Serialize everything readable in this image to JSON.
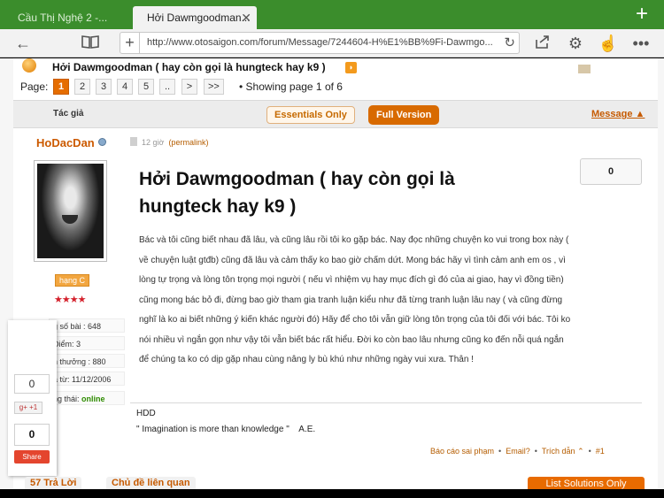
{
  "browser": {
    "tabs": [
      {
        "label": "Cầu Thị Nghệ 2 -...",
        "active": false
      },
      {
        "label": "Hởi Dawmgoodman...",
        "active": true
      }
    ],
    "url": "http://www.otosaigon.com/forum/Message/7244604-H%E1%BB%9Fi-Dawmgo...",
    "icons": [
      "back-icon",
      "reader-icon",
      "new-tab-icon",
      "reload-icon",
      "share-icon",
      "settings-icon",
      "gesture-icon",
      "more-icon"
    ]
  },
  "thread": {
    "title": "Hởi Dawmgoodman ( hay còn gọi là hungteck hay k9 )"
  },
  "pagination": {
    "label": "Page:",
    "pages": [
      "1",
      "2",
      "3",
      "4",
      "5",
      "..",
      ">",
      ">>"
    ],
    "current": "1",
    "showing": "• Showing page 1 of 6"
  },
  "header": {
    "author_col": "Tác giả",
    "essentials": "Essentials Only",
    "full_version": "Full Version",
    "message": "Message ▲"
  },
  "author": {
    "name": "HoDacDan",
    "rank": "hạng C",
    "stars": "★★★★",
    "stats": [
      {
        "text": "g số bài : 648"
      },
      {
        "text": "Điểm: 3"
      },
      {
        "text": "h thưởng : 880"
      },
      {
        "text": "a từ: 11/12/2006"
      }
    ],
    "status_label": "ng thái: ",
    "status_value": "online"
  },
  "share": {
    "count_top": "0",
    "gplus": "g+ +1",
    "count_bottom": "0",
    "share_label": "Share"
  },
  "post": {
    "time": "12 giờ",
    "permalink": "(permalink)",
    "votes": "0",
    "title": "Hởi Dawmgoodman ( hay còn gọi là hungteck hay k9 )",
    "body": "Bác và tôi cũng biết nhau đã lâu, và cũng lâu rồi tôi ko gặp bác. Nay đọc những chuyện ko vui trong box này ( về chuyện luật gtđb) cũng đã lâu và cảm thấy ko bao giờ chấm dứt. Mong bác hãy vì tình cảm anh em os , vì lòng tự trọng và lòng tôn trọng mọi người ( nếu vì nhiệm vụ hay mục đích gì đó của ai giao, hay vì đồng tiền) cũng mong bác bỏ đi, đừng bao giờ tham gia tranh luận kiểu như đã từng tranh luận lâu nay ( và cũng đừng nghĩ là ko ai biết những ý kiến khác người đó) Hãy để cho tôi vẫn giữ lòng tôn trọng của tôi đối với bác. Tôi ko nói nhiều vì ngắn gọn như vậy tôi vẫn biết bác rất hiểu. Đời ko còn bao lâu nhưng cũng ko đến nỗi quá ngắn để chúng ta ko có dịp gặp nhau cùng nâng ly bù khú như những ngày vui xưa. Thân !",
    "signature_line1": "HDD",
    "signature_line2": "\" Imagination is more than knowledge \"    A.E.",
    "actions": {
      "report": "Báo cáo sai phạm",
      "email": "Email?",
      "quote": "Trích dẫn",
      "number": "#1"
    }
  },
  "bottom": {
    "replies": "57 Trả Lời",
    "related": "Chủ đề liên quan",
    "solutions": "List Solutions Only"
  },
  "colors": {
    "tabbar": "#3b8d2c",
    "accent": "#e56d00",
    "link": "#b55d00"
  }
}
